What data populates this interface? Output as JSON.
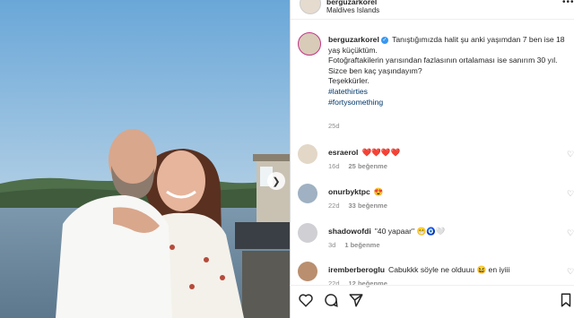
{
  "header": {
    "username": "berguzarkorel",
    "location": "Maldives Islands",
    "more_label": "•••"
  },
  "post": {
    "username": "berguzarkorel",
    "lines": [
      "Tanıştığımızda halit şu anki yaşımdan 7 ben ise 18 yaş küçüktüm.",
      "Fotoğraftakilerin yarısından fazlasının ortalaması ise sanırım 30 yıl.",
      "Sizce ben kaç yaşındayım?",
      "Teşekkürler."
    ],
    "hashtags": [
      "#latethirties",
      "#fortysomething"
    ],
    "time": "25d"
  },
  "comments": [
    {
      "username": "esraerol",
      "text": "❤️❤️❤️❤️",
      "time": "16d",
      "likes": "25 beğenme",
      "reply": ""
    },
    {
      "username": "onurbyktpc",
      "text": "😍",
      "time": "22d",
      "likes": "33 beğenme",
      "reply": ""
    },
    {
      "username": "shadowofdi",
      "text": "\"40 yapaar\" 😁🧿🤍",
      "time": "3d",
      "likes": "1 beğenme",
      "reply": ""
    },
    {
      "username": "iremberberoglu",
      "text": "Cabukkk söyle ne olduuu 😆 en iyiii",
      "time": "22d",
      "likes": "12 beğenme",
      "reply": ""
    }
  ],
  "colors": {
    "link": "#00376b",
    "verified": "#3897f0",
    "heart": "#ed4956",
    "meta": "#8e8e8e"
  }
}
